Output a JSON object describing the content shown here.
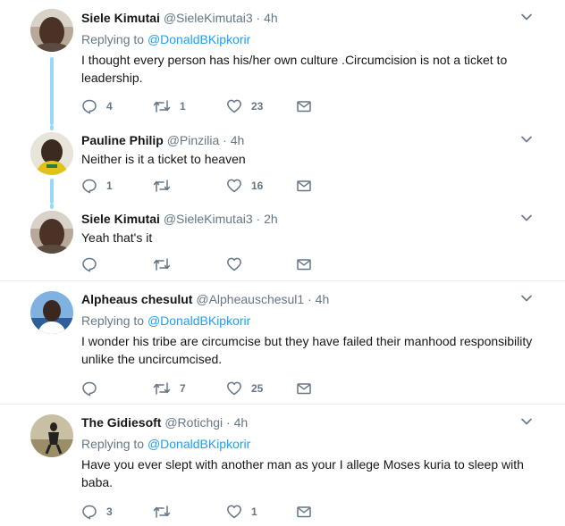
{
  "icons": {
    "reply": "reply-icon",
    "retweet": "retweet-icon",
    "like": "heart-icon",
    "dm": "envelope-icon",
    "menu": "chevron-down-icon"
  },
  "colors": {
    "link": "#1da1f2",
    "secondary": "#657786",
    "thread_line": "#9ad7f8",
    "divider": "#e6ecf0"
  },
  "tweets": [
    {
      "name": "Siele Kimutai",
      "handle": "@SieleKimutai3",
      "separator": "·",
      "time": "4h",
      "replying_prefix": "Replying to ",
      "replying_to": "@DonaldBKipkorir",
      "text": "I thought every person has his/her   own culture .Circumcision is not a ticket to leadership.",
      "replies": "4",
      "retweets": "1",
      "likes": "23"
    },
    {
      "name": "Pauline Philip",
      "handle": "@Pinzilia",
      "separator": "·",
      "time": "4h",
      "text": "Neither is it a ticket to heaven",
      "replies": "1",
      "retweets": "",
      "likes": "16"
    },
    {
      "name": "Siele Kimutai",
      "handle": "@SieleKimutai3",
      "separator": "·",
      "time": "2h",
      "text": "Yeah that's it",
      "replies": "",
      "retweets": "",
      "likes": ""
    },
    {
      "name": "Alpheaus chesulut",
      "handle": "@Alpheauschesul1",
      "separator": "·",
      "time": "4h",
      "replying_prefix": "Replying to ",
      "replying_to": "@DonaldBKipkorir",
      "text": "I wonder his tribe are circumcise but they have failed their manhood responsibility unlike the uncircumcised.",
      "replies": "",
      "retweets": "7",
      "likes": "25"
    },
    {
      "name": "The Gidiesoft",
      "handle": "@Rotichgi",
      "separator": "·",
      "time": "4h",
      "replying_prefix": "Replying to ",
      "replying_to": "@DonaldBKipkorir",
      "text": "Have you ever slept with another man as your I allege Moses kuria to sleep with baba.",
      "replies": "3",
      "retweets": "",
      "likes": "1"
    }
  ]
}
